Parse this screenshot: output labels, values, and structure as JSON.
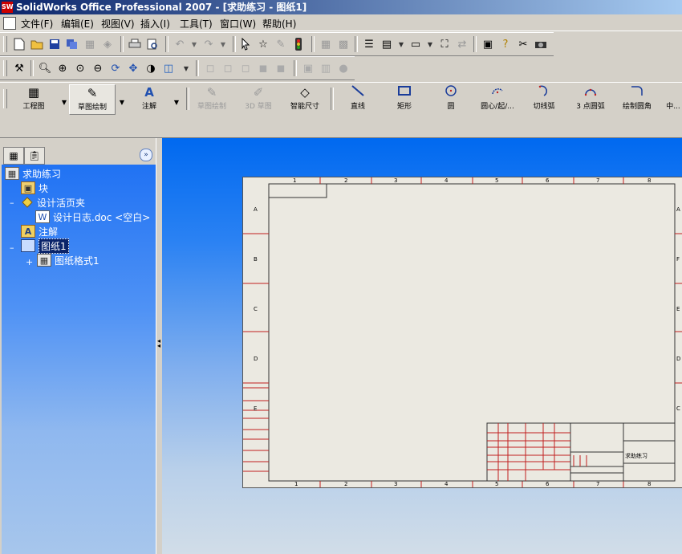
{
  "window": {
    "title": "SolidWorks Office Professional 2007 - [求助练习 - 图纸1]",
    "app_icon_text": "SW"
  },
  "menu": [
    "文件(F)",
    "编辑(E)",
    "视图(V)",
    "插入(I)",
    "工具(T)",
    "窗口(W)",
    "帮助(H)"
  ],
  "command_manager": [
    {
      "label": "工程图"
    },
    {
      "label": "草图绘制"
    },
    {
      "label": "注解"
    },
    {
      "label": "草图绘制"
    },
    {
      "label": "3D 草图"
    },
    {
      "label": "智能尺寸"
    },
    {
      "label": "直线"
    },
    {
      "label": "矩形"
    },
    {
      "label": "圆"
    },
    {
      "label": "圆心/起/..."
    },
    {
      "label": "切线弧"
    },
    {
      "label": "3 点圆弧"
    },
    {
      "label": "绘制圆角"
    },
    {
      "label": "中..."
    }
  ],
  "tree": {
    "root": "求助练习",
    "items": [
      "块",
      "设计活页夹",
      "设计日志.doc <空白>",
      "注解",
      "图纸1",
      "图纸格式1"
    ]
  },
  "sheet": {
    "col_labels": [
      "1",
      "2",
      "3",
      "4",
      "5",
      "6",
      "7",
      "8"
    ],
    "row_labels": [
      "A",
      "B",
      "C",
      "D",
      "E",
      "F"
    ],
    "title_block_name": "求助练习"
  }
}
